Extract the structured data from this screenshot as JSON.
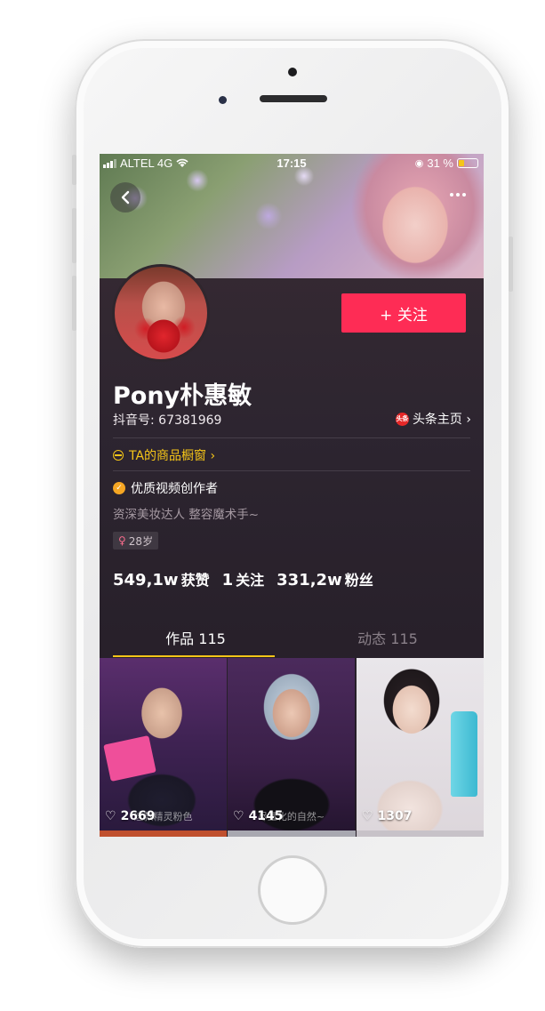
{
  "status_bar": {
    "carrier": "ALTEL 4G",
    "time": "17:15",
    "battery": "31 %",
    "battery_level": 0.31
  },
  "header": {
    "back_icon": "chevron-left-icon",
    "more_icon": "ellipsis-icon"
  },
  "profile": {
    "follow_label": "+ 关注",
    "name": "Pony朴惠敏",
    "douyin_id": "抖音号: 67381969",
    "toutiao_logo_text": "头条",
    "toutiao_label": "头条主页 ›",
    "shop_label": "TA的商品橱窗 ›",
    "verified_label": "优质视频创作者",
    "bio": "资深美妆达人 整容魔术手~",
    "age": "28岁"
  },
  "stats": {
    "likes_value": "549,1w",
    "likes_label": "获赞",
    "following_value": "1",
    "following_label": "关注",
    "followers_value": "331,2w",
    "followers_label": "粉丝"
  },
  "tabs": [
    {
      "label": "作品 115",
      "active": true
    },
    {
      "label": "动态 115",
      "active": false
    }
  ],
  "videos": [
    {
      "likes": "2669",
      "caption": "这款精灵粉色"
    },
    {
      "likes": "4145",
      "caption": "尽量化的自然~"
    },
    {
      "likes": "1307",
      "caption": ""
    }
  ],
  "colors": {
    "accent": "#fe2c55",
    "gold": "#f5c518",
    "background": "#2d2530"
  }
}
